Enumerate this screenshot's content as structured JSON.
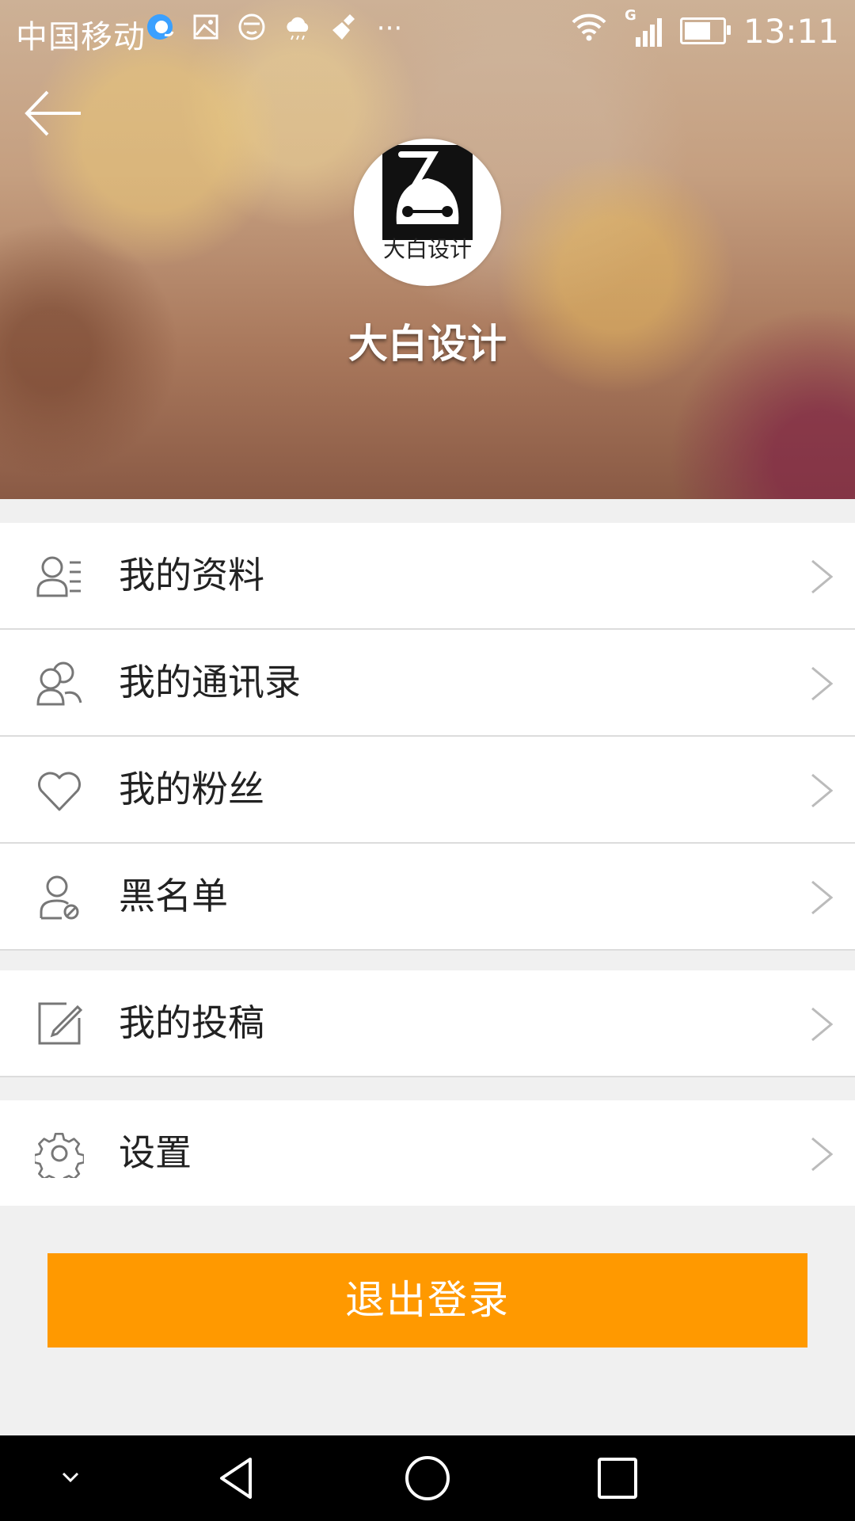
{
  "status_bar": {
    "carrier": "中国移动",
    "time": "13:11",
    "network": "G",
    "more": "···",
    "icons": [
      "browser-icon",
      "gallery-icon",
      "face-icon",
      "cloud-icon",
      "clean-icon",
      "more-icon",
      "wifi-icon",
      "signal-icon",
      "battery-icon"
    ]
  },
  "header": {
    "back_icon": "back-arrow-icon",
    "avatar_text": "大白设计",
    "profile_name": "大白设计"
  },
  "menu": {
    "group1": [
      {
        "label": "我的资料",
        "icon": "profile-icon"
      },
      {
        "label": "我的通讯录",
        "icon": "contacts-icon"
      },
      {
        "label": "我的粉丝",
        "icon": "heart-icon"
      },
      {
        "label": "黑名单",
        "icon": "blacklist-icon"
      }
    ],
    "group2": [
      {
        "label": "我的投稿",
        "icon": "edit-icon"
      }
    ],
    "group3": [
      {
        "label": "设置",
        "icon": "gear-icon"
      }
    ]
  },
  "logout_label": "退出登录",
  "colors": {
    "accent": "#ff9900",
    "nav_bar": "#000000",
    "background": "#f0f0f0"
  }
}
